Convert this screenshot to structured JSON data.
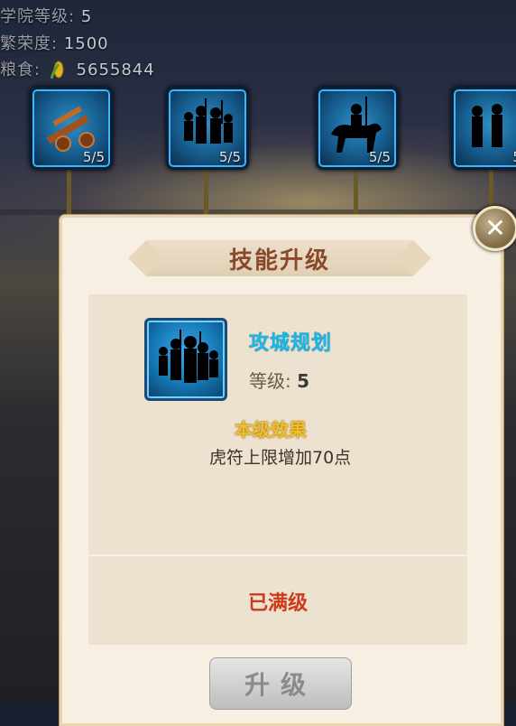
{
  "stats": {
    "academy_label": "学院等级:",
    "academy_value": "5",
    "prosperity_label": "繁荣度:",
    "prosperity_value": "1500",
    "food_label": "粮食:",
    "food_value": "5655844"
  },
  "skill_nodes": [
    {
      "icon": "catapult-icon",
      "count": "5/5"
    },
    {
      "icon": "troops-icon",
      "count": "5/5"
    },
    {
      "icon": "cavalry-icon",
      "count": "5/5"
    },
    {
      "icon": "soldiers-icon",
      "count": "5/"
    }
  ],
  "dialog": {
    "title": "技能升级",
    "skill_name": "攻城规划",
    "level_label": "等级:",
    "level_value": "5",
    "effect_heading": "本级效果",
    "effect_text": "虎符上限增加70点",
    "status": "已满级",
    "upgrade_button": "升级"
  },
  "colors": {
    "skill_name": "#1ab8e6",
    "effect_heading": "#f2c020",
    "status": "#cc3a1a",
    "title": "#8a4a2a"
  }
}
